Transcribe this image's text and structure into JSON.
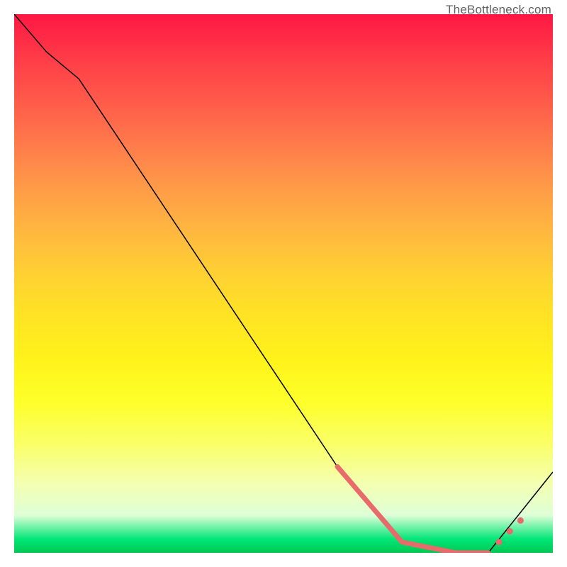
{
  "watermark": "TheBottleneck.com",
  "chart_data": {
    "type": "line",
    "title": "",
    "xlabel": "",
    "ylabel": "",
    "xlim": [
      0,
      100
    ],
    "ylim": [
      0,
      100
    ],
    "series": [
      {
        "name": "curve",
        "x": [
          0,
          6,
          12,
          60,
          72,
          82,
          88,
          100
        ],
        "y": [
          100,
          93,
          88,
          16,
          2,
          0,
          0,
          15
        ]
      }
    ],
    "highlight_segment": {
      "name": "flat-region",
      "x_start": 60,
      "x_end": 88
    },
    "markers": [
      {
        "x": 90,
        "y": 2
      },
      {
        "x": 92,
        "y": 4
      },
      {
        "x": 94,
        "y": 6
      }
    ],
    "gradient_stops": [
      {
        "pos": 0.0,
        "color": "#ff1744"
      },
      {
        "pos": 0.5,
        "color": "#ffe324"
      },
      {
        "pos": 0.93,
        "color": "#dfffd8"
      },
      {
        "pos": 1.0,
        "color": "#00c853"
      }
    ]
  }
}
